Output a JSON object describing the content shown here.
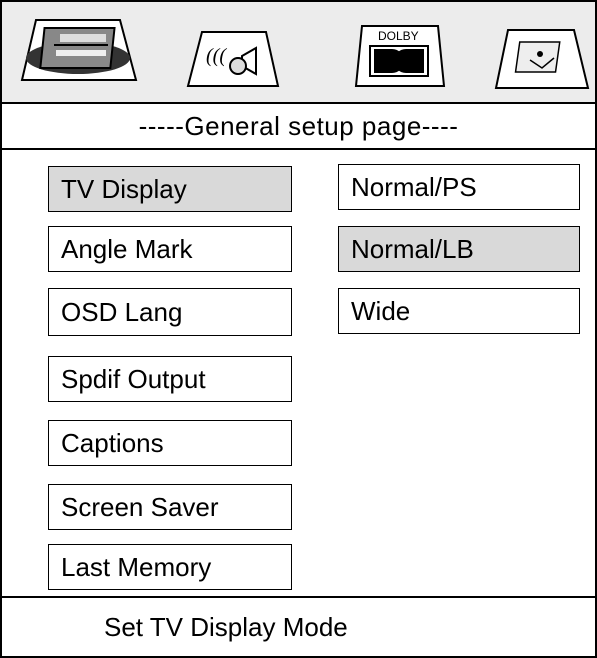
{
  "tabs": [
    {
      "name": "general-setup-tab",
      "icon": "tv-screen-icon",
      "active": true
    },
    {
      "name": "audio-setup-tab",
      "icon": "speaker-sound-icon",
      "active": false
    },
    {
      "name": "dolby-setup-tab",
      "icon": "dolby-logo-icon",
      "label": "DOLBY",
      "active": false
    },
    {
      "name": "preference-tab",
      "icon": "preference-picture-icon",
      "active": false
    }
  ],
  "page_title": "-----General setup page----",
  "menu": {
    "items": [
      {
        "label": "TV Display",
        "selected": true
      },
      {
        "label": "Angle Mark",
        "selected": false
      },
      {
        "label": "OSD  Lang",
        "selected": false
      },
      {
        "label": "Spdif Output",
        "selected": false
      },
      {
        "label": "Captions",
        "selected": false
      },
      {
        "label": "Screen Saver",
        "selected": false
      },
      {
        "label": "Last Memory",
        "selected": false
      }
    ]
  },
  "options": {
    "items": [
      {
        "label": "Normal/PS",
        "selected": false
      },
      {
        "label": "Normal/LB",
        "selected": true
      },
      {
        "label": "Wide",
        "selected": false
      }
    ]
  },
  "status": "Set TV Display Mode",
  "colors": {
    "highlight": "#d9d9d9",
    "border": "#000000",
    "tabbar": "#ececec"
  }
}
